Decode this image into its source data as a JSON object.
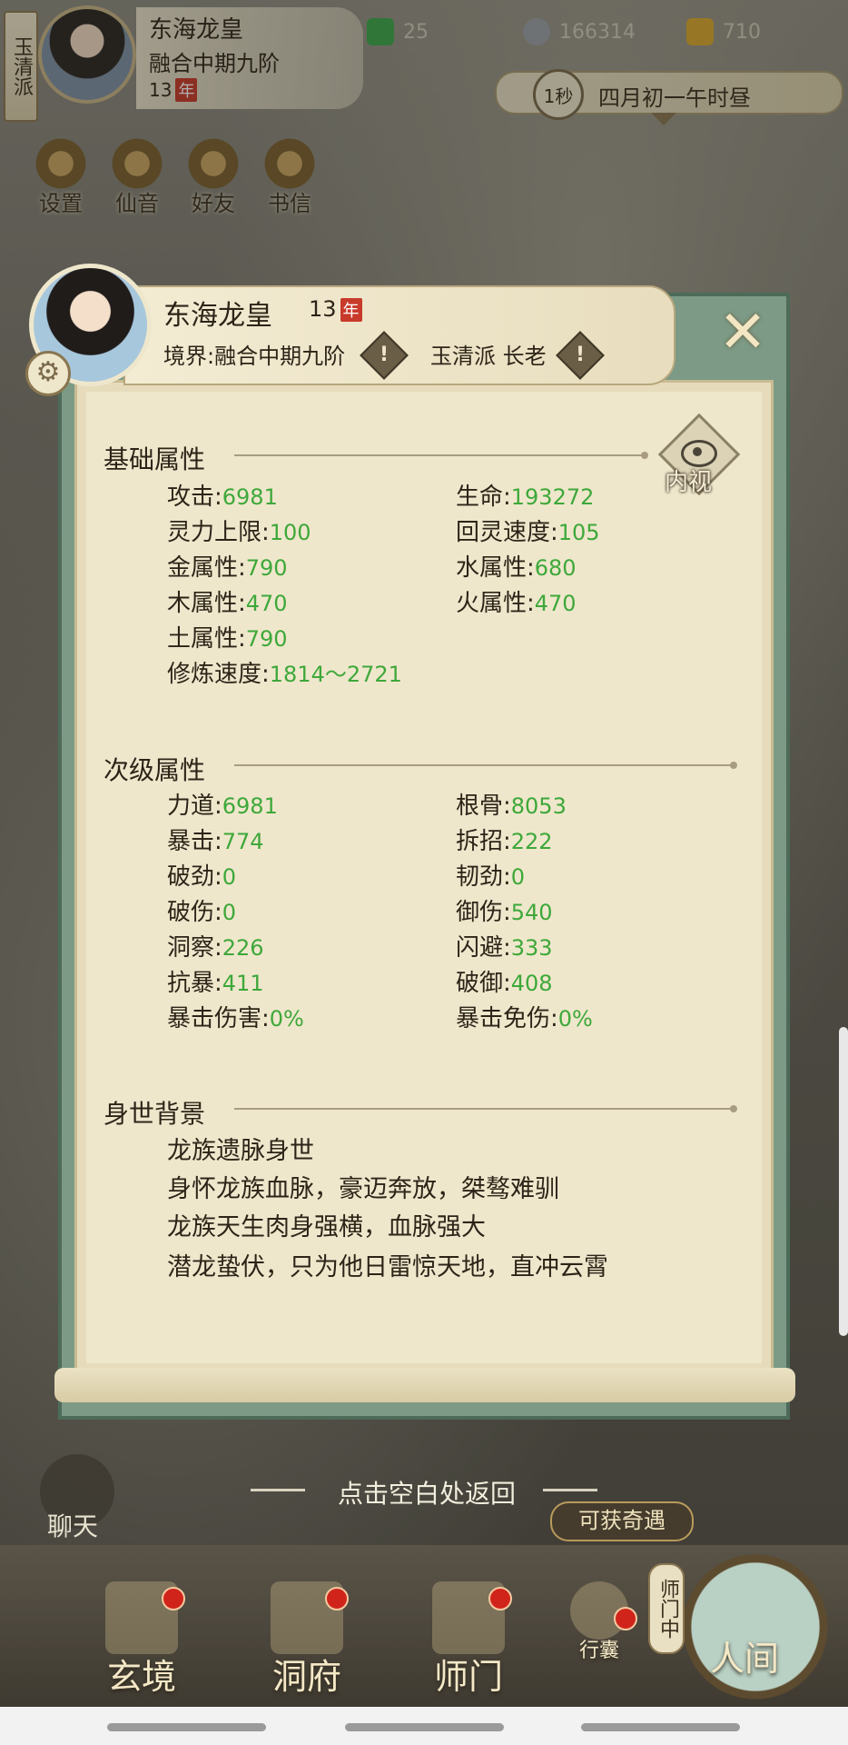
{
  "hud": {
    "sect": "玉清派",
    "name": "东海龙皇",
    "realm": "融合中期九阶",
    "age": "13",
    "nian": "年",
    "resources": [
      {
        "icon": "jade-icon",
        "value": "25",
        "color": "#3aa64a"
      },
      {
        "icon": "coin-icon",
        "value": "166314",
        "color": "#9aa0a8"
      },
      {
        "icon": "gold-icon",
        "value": "710",
        "color": "#d9a82e"
      }
    ],
    "time_speed": "1秒",
    "date": "四月初一午时昼",
    "buttons": [
      "设置",
      "仙音",
      "好友",
      "书信"
    ]
  },
  "panel": {
    "name": "东海龙皇",
    "age": "13",
    "nian": "年",
    "realm": "境界:融合中期九阶",
    "sect": "玉清派 长老",
    "eye_label": "内视",
    "basic": {
      "title": "基础属性",
      "left": [
        {
          "k": "攻击:",
          "v": "6981"
        },
        {
          "k": "灵力上限:",
          "v": "100"
        },
        {
          "k": "金属性:",
          "v": "790"
        },
        {
          "k": "木属性:",
          "v": "470"
        },
        {
          "k": "土属性:",
          "v": "790"
        },
        {
          "k": "修炼速度:",
          "v": "1814～2721"
        }
      ],
      "right": [
        {
          "k": "生命:",
          "v": "193272"
        },
        {
          "k": "回灵速度:",
          "v": "105"
        },
        {
          "k": "水属性:",
          "v": "680"
        },
        {
          "k": "火属性:",
          "v": "470"
        }
      ]
    },
    "secondary": {
      "title": "次级属性",
      "left": [
        {
          "k": "力道:",
          "v": "6981"
        },
        {
          "k": "暴击:",
          "v": "774"
        },
        {
          "k": "破劲:",
          "v": "0"
        },
        {
          "k": "破伤:",
          "v": "0"
        },
        {
          "k": "洞察:",
          "v": "226"
        },
        {
          "k": "抗暴:",
          "v": "411"
        },
        {
          "k": "暴击伤害:",
          "v": "0%"
        }
      ],
      "right": [
        {
          "k": "根骨:",
          "v": "8053"
        },
        {
          "k": "拆招:",
          "v": "222"
        },
        {
          "k": "韧劲:",
          "v": "0"
        },
        {
          "k": "御伤:",
          "v": "540"
        },
        {
          "k": "闪避:",
          "v": "333"
        },
        {
          "k": "破御:",
          "v": "408"
        },
        {
          "k": "暴击免伤:",
          "v": "0%"
        }
      ]
    },
    "background": {
      "title": "身世背景",
      "lines": [
        "龙族遗脉身世",
        "身怀龙族血脉，豪迈奔放，桀骜难驯",
        "龙族天生肉身强横，血脉强大",
        "潜龙蛰伏，只为他日雷惊天地，直冲云霄"
      ]
    }
  },
  "bottom": {
    "return_hint": "点击空白处返回",
    "chat": "聊天",
    "qiyu": "可获奇遇",
    "shimen": "师门中",
    "nav": [
      "玄境",
      "洞府",
      "师门",
      "行囊",
      "人间"
    ]
  },
  "colors": {
    "value_green": "#3ea83a",
    "panel_green": "#7c9a86",
    "paper": "#efe7cc"
  }
}
